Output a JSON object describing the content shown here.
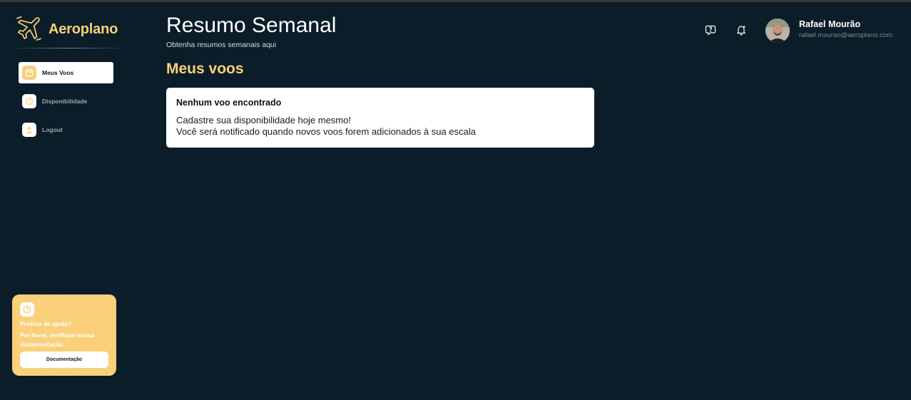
{
  "brand": {
    "name": "Aeroplano",
    "logo_icon": "airplane-icon",
    "accent_color": "#f9cf7a"
  },
  "sidebar": {
    "items": [
      {
        "label": "Meus Voos",
        "icon": "calendar-icon",
        "active": true
      },
      {
        "label": "Disponibilidade",
        "icon": "clock-icon",
        "active": false
      },
      {
        "label": "Logout",
        "icon": "user-icon",
        "active": false
      }
    ],
    "help": {
      "icon": "question-icon",
      "title": "Precisa de ajuda?",
      "text": "Por favor, verifique nossa documentação",
      "button_label": "Documentação"
    }
  },
  "header": {
    "title": "Resumo Semanal",
    "subtitle": "Obtenha resumos semanais aqui",
    "help_icon": "chat-question-icon",
    "notification_icon": "bell-icon",
    "user": {
      "name": "Rafael Mourão",
      "email": "rafael.mourao@aeroplano.com"
    }
  },
  "main": {
    "section_title": "Meus voos",
    "empty_state": {
      "title": "Nenhum voo encontrado",
      "line1": "Cadastre sua disponibilidade hoje mesmo!",
      "line2": "Você será notificado quando novos voos forem adicionados à sua escala"
    }
  },
  "colors": {
    "background": "#0b1d28",
    "accent": "#f9cf7a",
    "card": "#ffffff"
  }
}
